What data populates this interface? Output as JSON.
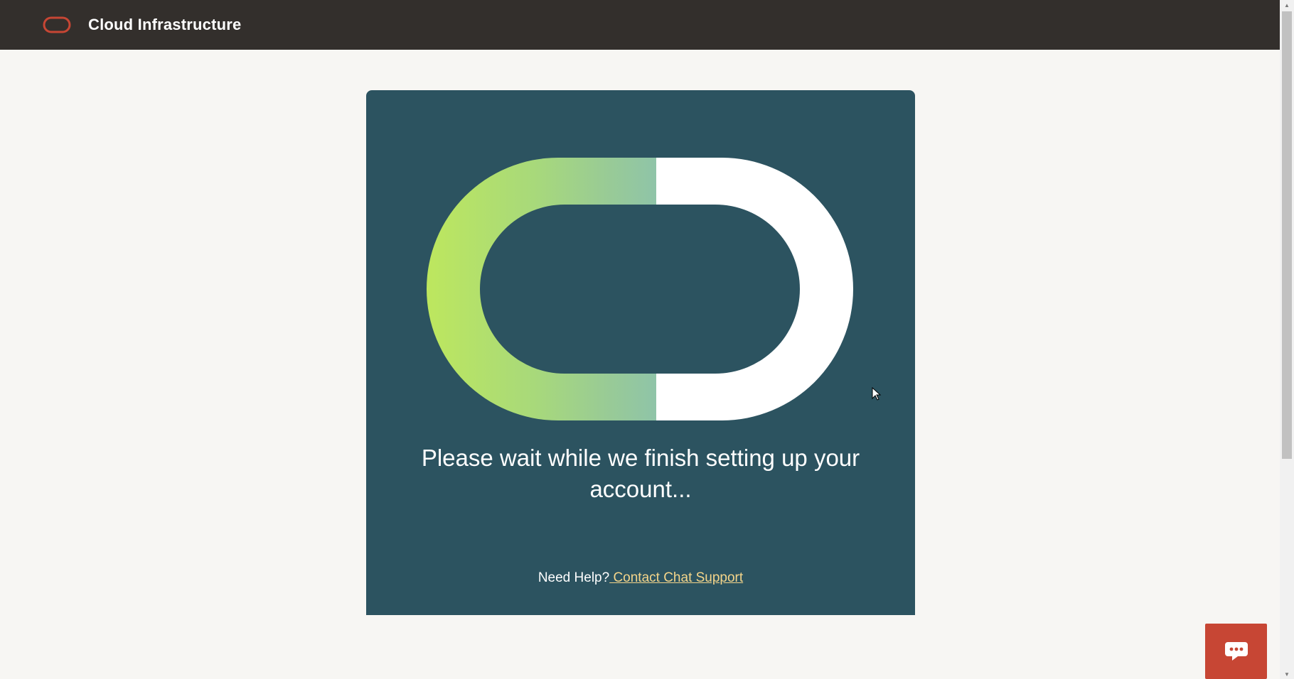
{
  "header": {
    "title": "Cloud Infrastructure",
    "logo_icon": "oracle-logo-icon",
    "logo_color": "#c74634",
    "background": "#332f2c"
  },
  "card": {
    "background": "#2c5360",
    "loader_icon": "loading-ring-icon",
    "message": "Please wait while we finish setting up your account...",
    "help_text": "Need Help?",
    "help_link": " Contact Chat Support",
    "link_color": "#f4d58a"
  },
  "chat": {
    "icon": "chat-bubble-icon",
    "background": "#c74634"
  },
  "scrollbar": {
    "up_icon": "scroll-up-icon",
    "down_icon": "scroll-down-icon"
  }
}
